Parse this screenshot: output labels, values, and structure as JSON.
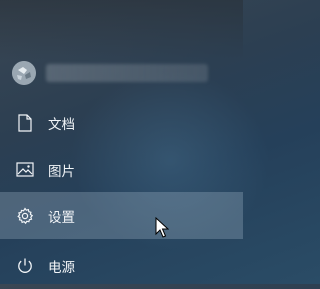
{
  "start_menu": {
    "account": {
      "icon": "user-avatar-icon",
      "name_hidden": true
    },
    "items": [
      {
        "label": "文档",
        "icon": "document-icon"
      },
      {
        "label": "图片",
        "icon": "pictures-icon"
      },
      {
        "label": "设置",
        "icon": "gear-icon",
        "state": "hover"
      },
      {
        "label": "电源",
        "icon": "power-icon"
      }
    ]
  },
  "colors": {
    "hover_row": "#A9BCCD",
    "text": "#F2F5F8",
    "background": "#2C3F52"
  }
}
